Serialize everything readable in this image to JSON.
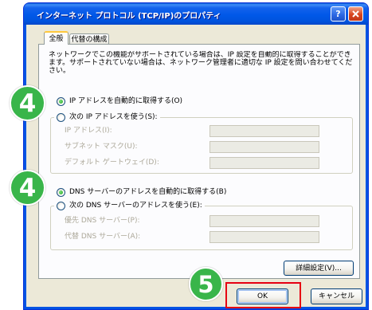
{
  "window": {
    "title": "インターネット プロトコル (TCP/IP)のプロパティ",
    "help_label": "?",
    "help_icon": "help-icon",
    "close_icon": "close-icon"
  },
  "tabs": [
    {
      "label": "全般",
      "active": true
    },
    {
      "label": "代替の構成",
      "active": false
    }
  ],
  "general": {
    "description": "ネットワークでこの機能がサポートされている場合は、IP 設定を自動的に取得することができます。サポートされていない場合は、ネットワーク管理者に適切な IP 設定を問い合わせてください。",
    "ip": {
      "auto": {
        "label": "IP アドレスを自動的に取得する(O)",
        "selected": true
      },
      "manual": {
        "label": "次の IP アドレスを使う(S):",
        "selected": false
      },
      "fields": [
        {
          "label": "IP アドレス(I):",
          "enabled": false
        },
        {
          "label": "サブネット マスク(U):",
          "enabled": false
        },
        {
          "label": "デフォルト ゲートウェイ(D):",
          "enabled": false
        }
      ]
    },
    "dns": {
      "auto": {
        "label": "DNS サーバーのアドレスを自動的に取得する(B)",
        "selected": true
      },
      "manual": {
        "label": "次の DNS サーバーのアドレスを使う(E):",
        "selected": false
      },
      "fields": [
        {
          "label": "優先 DNS サーバー(P):",
          "enabled": false
        },
        {
          "label": "代替 DNS サーバー(A):",
          "enabled": false
        }
      ]
    },
    "advanced_button": "詳細設定(V)..."
  },
  "footer": {
    "ok_button": "OK",
    "cancel_button": "キャンセル"
  },
  "annotations": [
    {
      "label": "4"
    },
    {
      "label": "4"
    },
    {
      "label": "5"
    }
  ],
  "colors": {
    "title_bar": "#0054E3",
    "dialog_face": "#ECE9D8",
    "annotation_green": "#39B54A",
    "highlight_red": "#E60012",
    "close_button": "#D8441E",
    "radio_dot": "#21A121"
  }
}
